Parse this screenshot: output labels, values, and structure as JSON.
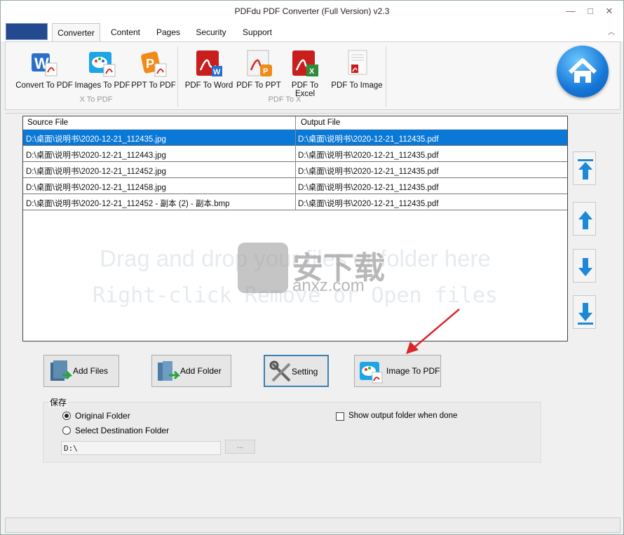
{
  "window": {
    "title": "PDFdu PDF Converter (Full Version) v2.3"
  },
  "tabs": [
    {
      "label": "Converter",
      "active": true
    },
    {
      "label": "Content"
    },
    {
      "label": "Pages"
    },
    {
      "label": "Security"
    },
    {
      "label": "Support"
    }
  ],
  "ribbon": {
    "group1": {
      "label": "X To PDF",
      "buttons": [
        {
          "label": "Convert To PDF",
          "icon": "word-to-pdf-icon"
        },
        {
          "label": "Images To PDF",
          "icon": "image-to-pdf-icon"
        },
        {
          "label": "PPT To PDF",
          "icon": "ppt-to-pdf-icon"
        }
      ]
    },
    "group2": {
      "label": "PDF To X",
      "buttons": [
        {
          "label": "PDF To Word",
          "icon": "pdf-to-word-icon"
        },
        {
          "label": "PDF To PPT",
          "icon": "pdf-to-ppt-icon"
        },
        {
          "label": "PDF To Excel",
          "icon": "pdf-to-excel-icon"
        },
        {
          "label": "PDF To Image",
          "icon": "pdf-to-image-icon"
        }
      ]
    }
  },
  "file_list": {
    "columns": [
      "Source File",
      "Output File"
    ],
    "rows": [
      {
        "source": "D:\\桌面\\说明书\\2020-12-21_112435.jpg",
        "output": "D:\\桌面\\说明书\\2020-12-21_112435.pdf",
        "selected": true
      },
      {
        "source": "D:\\桌面\\说明书\\2020-12-21_112443.jpg",
        "output": "D:\\桌面\\说明书\\2020-12-21_112435.pdf"
      },
      {
        "source": "D:\\桌面\\说明书\\2020-12-21_112452.jpg",
        "output": "D:\\桌面\\说明书\\2020-12-21_112435.pdf"
      },
      {
        "source": "D:\\桌面\\说明书\\2020-12-21_112458.jpg",
        "output": "D:\\桌面\\说明书\\2020-12-21_112435.pdf"
      },
      {
        "source": "D:\\桌面\\说明书\\2020-12-21_112452 - 副本 (2) - 副本.bmp",
        "output": "D:\\桌面\\说明书\\2020-12-21_112435.pdf"
      }
    ],
    "hint_line1": "Drag and drop your files or folder here",
    "hint_line2": "Right-click Remove or Open files"
  },
  "watermark": {
    "line1": "安下载",
    "line2": "anxz.com"
  },
  "actions": {
    "add_files": "Add Files",
    "add_folder": "Add Folder",
    "setting": "Setting",
    "convert": "Image To PDF"
  },
  "save": {
    "label": "保存",
    "original_folder": "Original Folder",
    "select_destination": "Select Destination Folder",
    "show_output": "Show output folder when done",
    "path": "D:\\",
    "browse": "..."
  },
  "colors": {
    "selection": "#0a78d7",
    "accent_arrow": "#d9262b",
    "move_arrow": "#1e88d8"
  }
}
